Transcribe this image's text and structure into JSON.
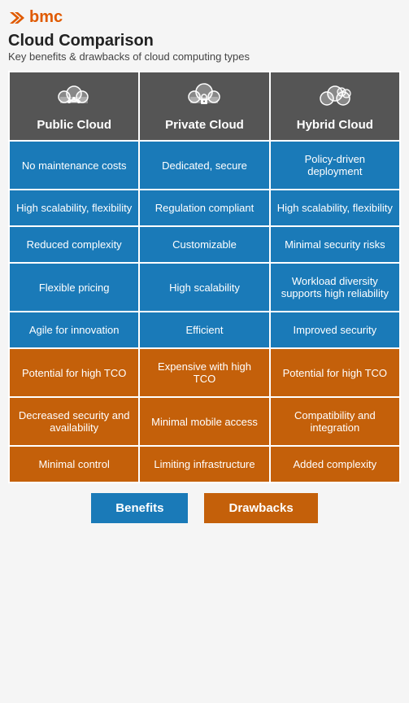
{
  "logo": {
    "text": "bmc"
  },
  "title": "Cloud Comparison",
  "subtitle": "Key benefits & drawbacks of cloud computing types",
  "columns": [
    {
      "id": "public",
      "label": "Public Cloud",
      "icon": "☁"
    },
    {
      "id": "private",
      "label": "Private Cloud",
      "icon": "☁"
    },
    {
      "id": "hybrid",
      "label": "Hybrid Cloud",
      "icon": "☁"
    }
  ],
  "rows": [
    {
      "type": "blue",
      "cells": [
        "No maintenance costs",
        "Dedicated, secure",
        "Policy-driven deployment"
      ]
    },
    {
      "type": "blue",
      "cells": [
        "High scalability, flexibility",
        "Regulation compliant",
        "High scalability, flexibility"
      ]
    },
    {
      "type": "blue",
      "cells": [
        "Reduced complexity",
        "Customizable",
        "Minimal security risks"
      ]
    },
    {
      "type": "blue",
      "cells": [
        "Flexible pricing",
        "High scalability",
        "Workload diversity supports high reliability"
      ]
    },
    {
      "type": "blue",
      "cells": [
        "Agile for innovation",
        "Efficient",
        "Improved security"
      ]
    },
    {
      "type": "orange",
      "cells": [
        "Potential for high TCO",
        "Expensive with high TCO",
        "Potential for high TCO"
      ]
    },
    {
      "type": "orange",
      "cells": [
        "Decreased security and availability",
        "Minimal mobile access",
        "Compatibility and integration"
      ]
    },
    {
      "type": "orange",
      "cells": [
        "Minimal control",
        "Limiting infrastructure",
        "Added complexity"
      ]
    }
  ],
  "legend": {
    "benefits_label": "Benefits",
    "drawbacks_label": "Drawbacks"
  }
}
